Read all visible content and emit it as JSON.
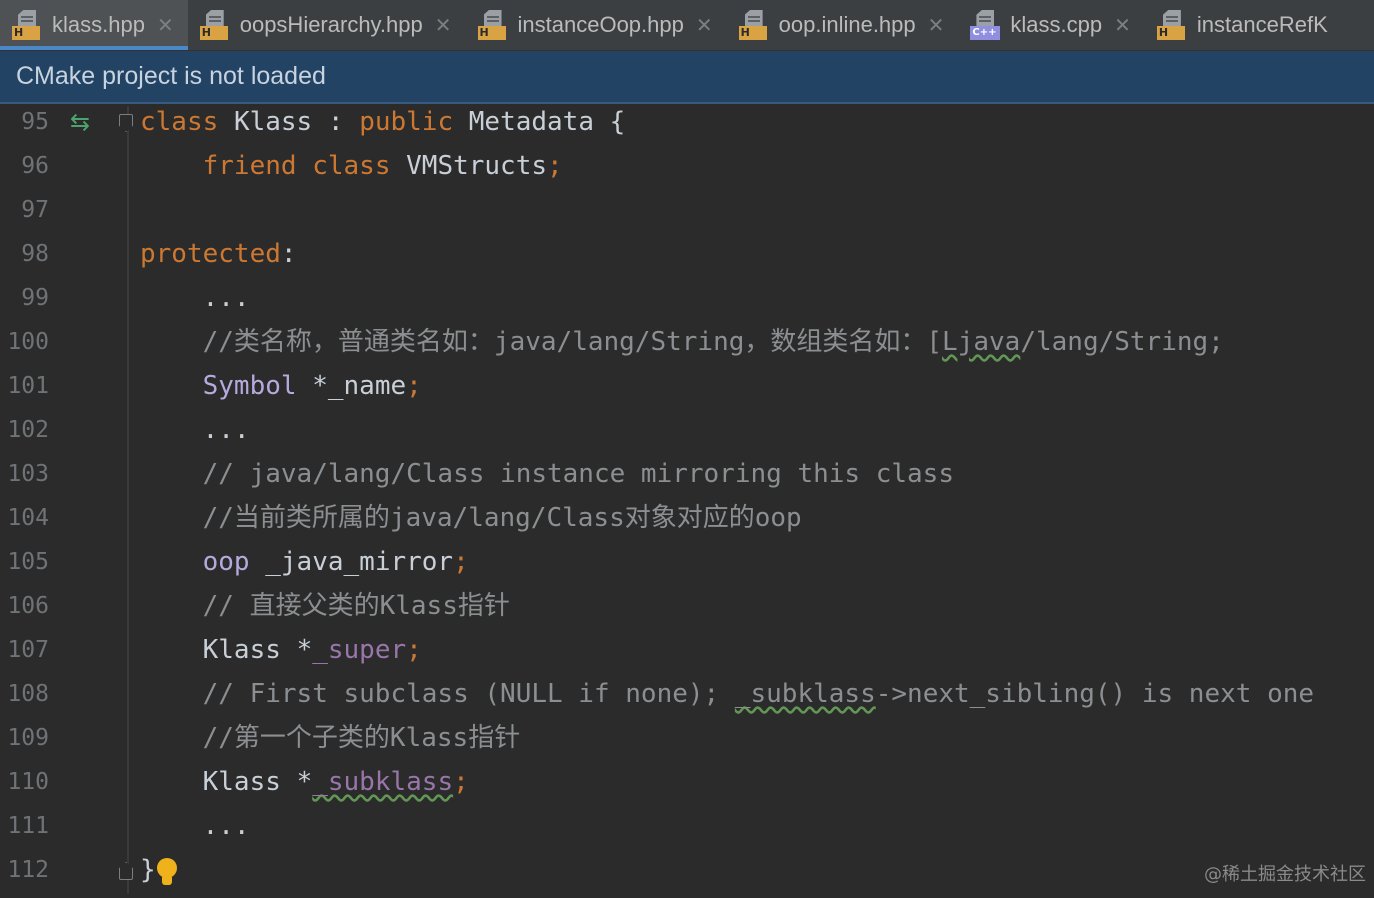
{
  "tabs": [
    {
      "label": "klass.hpp",
      "icon": "header-file-icon",
      "badge": "H",
      "active": true,
      "closable": true
    },
    {
      "label": "oopsHierarchy.hpp",
      "icon": "header-file-icon",
      "badge": "H",
      "active": false,
      "closable": true
    },
    {
      "label": "instanceOop.hpp",
      "icon": "header-file-icon",
      "badge": "H",
      "active": false,
      "closable": true
    },
    {
      "label": "oop.inline.hpp",
      "icon": "header-file-icon",
      "badge": "H",
      "active": false,
      "closable": true
    },
    {
      "label": "klass.cpp",
      "icon": "cpp-file-icon",
      "badge": "C++",
      "active": false,
      "closable": true
    },
    {
      "label": "instanceRefK",
      "icon": "header-file-icon",
      "badge": "H",
      "active": false,
      "closable": false
    }
  ],
  "notification": {
    "text": "CMake project is not loaded"
  },
  "editor": {
    "lines": [
      {
        "num": "95"
      },
      {
        "num": "96"
      },
      {
        "num": "97"
      },
      {
        "num": "98"
      },
      {
        "num": "99"
      },
      {
        "num": "100"
      },
      {
        "num": "101"
      },
      {
        "num": "102"
      },
      {
        "num": "103"
      },
      {
        "num": "104"
      },
      {
        "num": "105"
      },
      {
        "num": "106"
      },
      {
        "num": "107"
      },
      {
        "num": "108"
      },
      {
        "num": "109"
      },
      {
        "num": "110"
      },
      {
        "num": "111"
      },
      {
        "num": "112"
      }
    ],
    "code": {
      "l95": {
        "kw_class": "class",
        "name": "Klass",
        "colon": ":",
        "kw_public": "public",
        "base": "Metadata",
        "brace": "{"
      },
      "l96": {
        "kw_friend": "friend",
        "kw_class": "class",
        "name": "VMStructs",
        "semi": ";"
      },
      "l98": {
        "kw": "protected",
        "colon": ":"
      },
      "l99": {
        "text": "..."
      },
      "l100": {
        "a": "//类名称，普通类名如：java/lang/String，数组类名如：[",
        "b": "Ljava",
        "c": "/lang/String;"
      },
      "l101": {
        "type": "Symbol",
        "ptr": "*_name",
        "semi": ";"
      },
      "l102": {
        "text": "..."
      },
      "l103": {
        "text": "// java/lang/Class instance mirroring this class"
      },
      "l104": {
        "text": "//当前类所属的java/lang/Class对象对应的oop"
      },
      "l105": {
        "type": "oop",
        "field": "_java_mirror",
        "semi": ";"
      },
      "l106": {
        "text": "// 直接父类的Klass指针"
      },
      "l107": {
        "type": "Klass",
        "ptr": "*",
        "field": "_super",
        "semi": ";"
      },
      "l108": {
        "a": "// First subclass (NULL if none); ",
        "b": "_subklass",
        "c": "->next_sibling() is next one"
      },
      "l109": {
        "text": "//第一个子类的Klass指针"
      },
      "l110": {
        "type": "Klass",
        "ptr": "*",
        "field": "_subklass",
        "semi": ";"
      },
      "l111": {
        "text": "..."
      },
      "l112": {
        "brace": "}"
      }
    },
    "gutter_marker_icon": "override-arrows-icon",
    "intention_icon": "lightbulb-icon"
  },
  "watermark": "@稀土掘金技术社区",
  "colors": {
    "keyword": "#cc7832",
    "type": "#b6a9dc",
    "field": "#9876aa",
    "comment": "#8c8f91",
    "notification_bg": "#234365",
    "active_tab_underline": "#4a88c7"
  }
}
